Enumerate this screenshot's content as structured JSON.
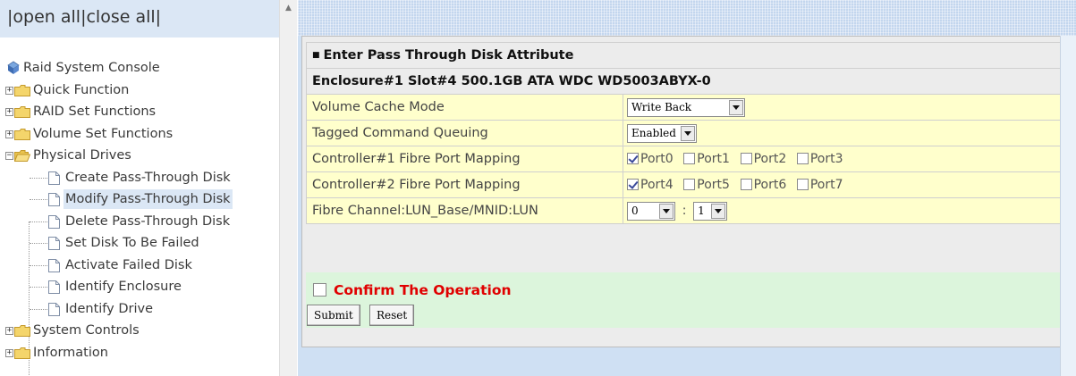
{
  "top_links": {
    "open_all": "open all",
    "close_all": "close all",
    "sep": "|"
  },
  "tree": {
    "root": "Raid System Console",
    "folders": {
      "quick": "Quick Function",
      "raid": "RAID Set Functions",
      "volume": "Volume Set Functions",
      "physical": "Physical Drives",
      "system": "System Controls",
      "info": "Information"
    },
    "physical_items": [
      "Create Pass-Through Disk",
      "Modify Pass-Through Disk",
      "Delete Pass-Through Disk",
      "Set Disk To Be Failed",
      "Activate Failed Disk",
      "Identify Enclosure",
      "Identify Drive"
    ]
  },
  "form": {
    "title": "Enter Pass Through Disk Attribute",
    "disk": "Enclosure#1 Slot#4 500.1GB ATA WDC WD5003ABYX-0",
    "rows": {
      "cache_label": "Volume Cache Mode",
      "cache_value": "Write Back",
      "tcq_label": "Tagged Command Queuing",
      "tcq_value": "Enabled",
      "c1_label": "Controller#1 Fibre Port Mapping",
      "c1_ports": [
        "Port0",
        "Port1",
        "Port2",
        "Port3"
      ],
      "c2_label": "Controller#2 Fibre Port Mapping",
      "c2_ports": [
        "Port4",
        "Port5",
        "Port6",
        "Port7"
      ],
      "lun_label": "Fibre Channel:LUN_Base/MNID:LUN",
      "lun_base": "0",
      "lun_sep": ":",
      "lun_value": "1"
    },
    "port_checked": {
      "c1": [
        true,
        false,
        false,
        false
      ],
      "c2": [
        true,
        false,
        false,
        false
      ]
    },
    "confirm_label": "Confirm The Operation",
    "submit": "Submit",
    "reset": "Reset"
  },
  "colors": {
    "nav_header_bg": "#dbe7f5",
    "row_bg": "#ffffcc",
    "confirm_bg": "#dcf5dc",
    "confirm_text": "#e00000",
    "folder_yellow": "#f4d56b"
  },
  "icons": {
    "root": "console-icon",
    "folder": "folder-icon",
    "page": "page-icon",
    "expand": "plus-box-icon",
    "collapse": "minus-box-icon"
  }
}
